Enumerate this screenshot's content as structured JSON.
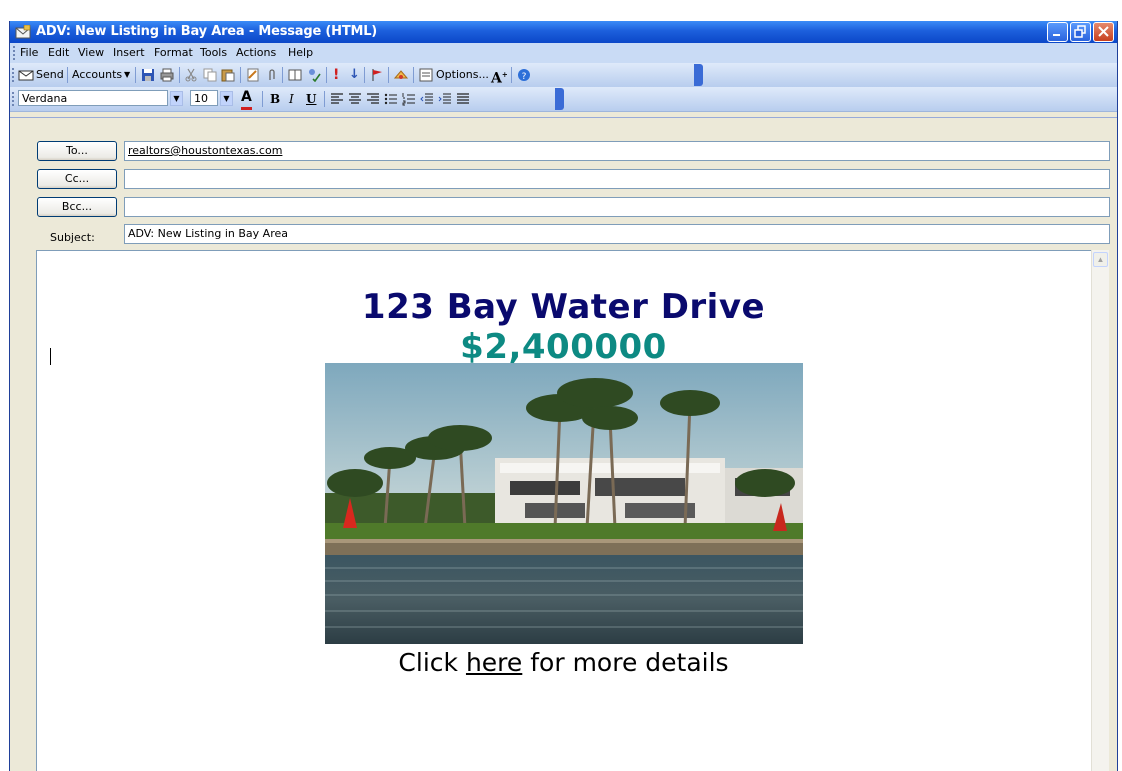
{
  "window": {
    "title": "ADV: New Listing in Bay Area - Message (HTML)",
    "controls": [
      "minimize",
      "restore",
      "close"
    ]
  },
  "menu": [
    "File",
    "Edit",
    "View",
    "Insert",
    "Format",
    "Tools",
    "Actions",
    "Help"
  ],
  "toolbar": {
    "send_label": "Send",
    "accounts_label": "Accounts",
    "options_label": "Options...",
    "icons": [
      "save-icon",
      "print-icon",
      "cut-icon",
      "copy-icon",
      "paste-icon",
      "insert-file-icon",
      "attach-icon",
      "address-book-icon",
      "check-names-icon",
      "importance-high-icon",
      "importance-low-icon",
      "flag-icon",
      "permissions-icon",
      "options-icon",
      "font-size-icon",
      "help-icon"
    ]
  },
  "format_bar": {
    "font": "Verdana",
    "size": "10",
    "buttons": [
      "font-color",
      "bold",
      "italic",
      "underline",
      "align-left",
      "center",
      "align-right",
      "bullets",
      "numbering",
      "decrease-indent",
      "increase-indent",
      "line-style"
    ]
  },
  "header": {
    "to_label": "To...",
    "cc_label": "Cc...",
    "bcc_label": "Bcc...",
    "subject_label": "Subject:",
    "to_value": "realtors@houstontexas.com",
    "cc_value": "",
    "bcc_value": "",
    "subject_value": "ADV: New Listing in Bay Area"
  },
  "message": {
    "headline": "123 Bay Water Drive",
    "price": "$2,400000",
    "click_prefix": "Click ",
    "link_text": "here",
    "click_suffix": " for more details"
  },
  "colors": {
    "title_bar": "#1c5fdc",
    "headline": "#0a0a6e",
    "price": "#0d8a83"
  }
}
